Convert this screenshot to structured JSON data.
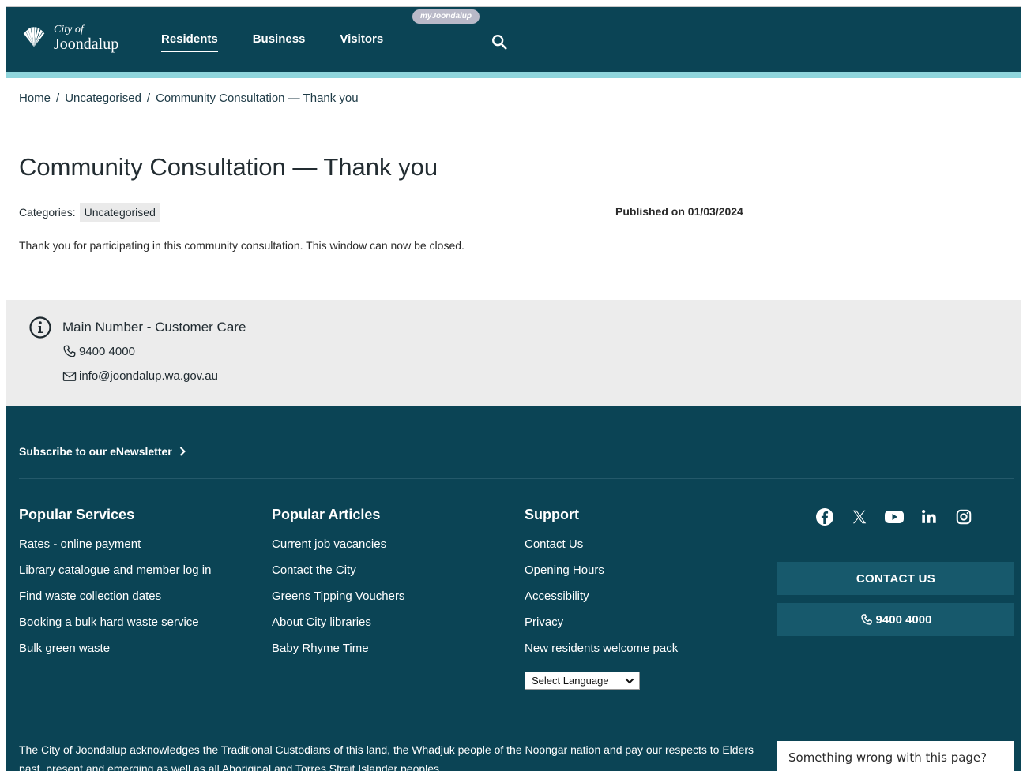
{
  "header": {
    "logo_line1": "City of",
    "logo_line2": "Joondalup",
    "nav": [
      "Residents",
      "Business",
      "Visitors"
    ],
    "pill_label": "myJoondalup"
  },
  "breadcrumb": [
    "Home",
    "Uncategorised",
    "Community Consultation — Thank you"
  ],
  "breadcrumb_sep": "/",
  "page": {
    "title": "Community Consultation — Thank you",
    "categories_label": "Categories:",
    "category": "Uncategorised",
    "published": "Published on 01/03/2024",
    "body": "Thank you for participating in this community consultation. This window can now be closed."
  },
  "contact": {
    "title": "Main Number - Customer Care",
    "phone": "9400 4000",
    "email": "info@joondalup.wa.gov.au"
  },
  "footer": {
    "subscribe": "Subscribe to our eNewsletter",
    "columns": [
      {
        "title": "Popular Services",
        "items": [
          "Rates - online payment",
          "Library catalogue and member log in",
          "Find waste collection dates",
          "Booking a bulk hard waste service",
          "Bulk green waste"
        ]
      },
      {
        "title": "Popular Articles",
        "items": [
          "Current job vacancies",
          "Contact the City",
          "Greens Tipping Vouchers",
          "About City libraries",
          "Baby Rhyme Time"
        ]
      },
      {
        "title": "Support",
        "items": [
          "Contact Us",
          "Opening Hours",
          "Accessibility",
          "Privacy",
          "New residents welcome pack"
        ]
      }
    ],
    "language_select": "Select Language",
    "social_icons": [
      "facebook-icon",
      "x-icon",
      "youtube-icon",
      "linkedin-icon",
      "instagram-icon"
    ],
    "contact_button": "CONTACT US",
    "phone_button": "9400 4000",
    "acknowledgement": "The City of Joondalup acknowledges the Traditional Custodians of this land, the Whadjuk people of the Noongar nation and pay our respects to Elders past, present and emerging as well as all Aboriginal and Torres Strait Islander peoples.",
    "feedback_button": "Something wrong with this page?"
  },
  "colors": {
    "header_bg": "#0b4455",
    "accent_stripe": "#8fd5dc",
    "button_bg": "#17596c",
    "contact_band_bg": "#ececec"
  }
}
